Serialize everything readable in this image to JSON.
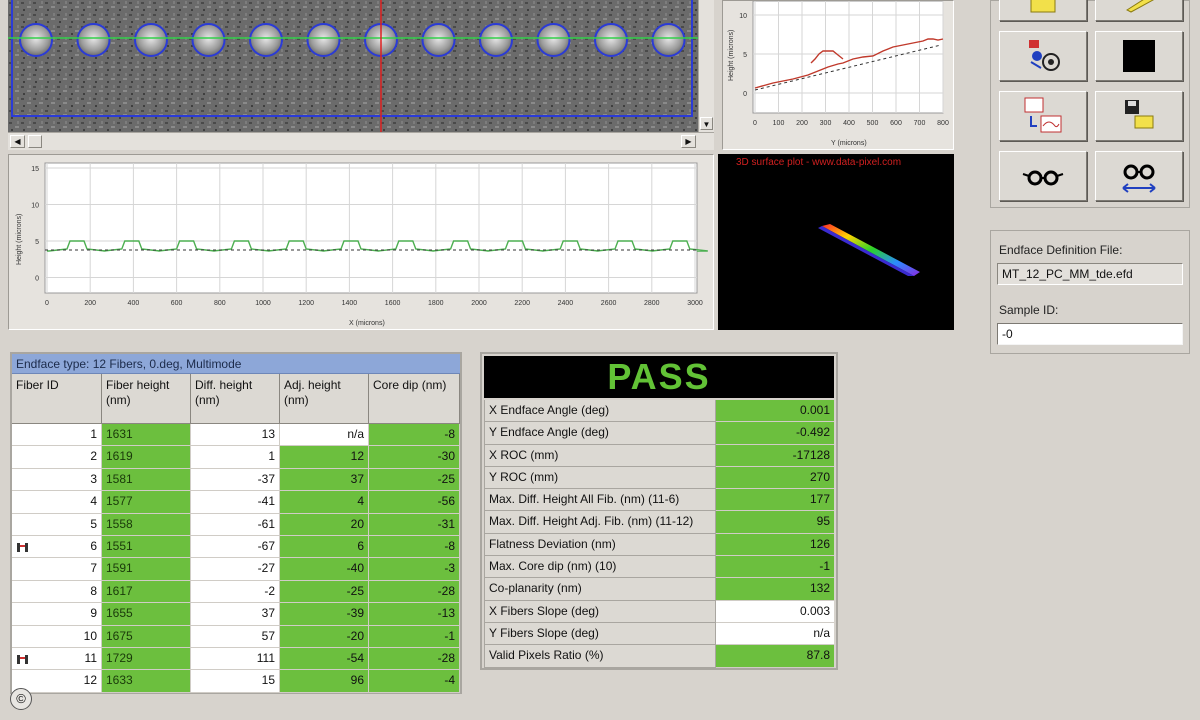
{
  "colors": {
    "pass_green": "#6cbf3e",
    "header_blue": "#8da7d8",
    "plot_green": "#4caf50",
    "plot_red": "#c0392b"
  },
  "y_profile_chart": {
    "ylabel": "Height (microns)",
    "xlabel": "Y (microns)",
    "y_ticks": [
      "10",
      "5",
      "0"
    ],
    "x_ticks": [
      "0",
      "100",
      "200",
      "300",
      "400",
      "500",
      "600",
      "700",
      "800"
    ]
  },
  "x_profile_chart": {
    "ylabel": "Height (microns)",
    "xlabel": "X (microns)",
    "y_ticks": [
      "15",
      "10",
      "5",
      "0"
    ],
    "x_ticks": [
      "0",
      "200",
      "400",
      "600",
      "800",
      "1000",
      "1200",
      "1400",
      "1600",
      "1800",
      "2000",
      "2200",
      "2400",
      "2600",
      "2800",
      "3000"
    ]
  },
  "surface_plot": {
    "title": "3D surface plot - www.data-pixel.com"
  },
  "tools": [
    "folder-icon",
    "pencil-icon",
    "measure-settings-icon",
    "black-square-icon",
    "compare-plot-icon",
    "save-open-icon",
    "glasses-icon",
    "glasses-compare-icon"
  ],
  "info": {
    "def_label": "Endface Definition File:",
    "def_value": "MT_12_PC_MM_tde.efd",
    "sample_label": "Sample ID:",
    "sample_value": "-0"
  },
  "fiber_table": {
    "title": "Endface type: 12 Fibers, 0.deg, Multimode",
    "columns": [
      "Fiber ID",
      "Fiber height (nm)",
      "Diff. height (nm)",
      "Adj. height (nm)",
      "Core dip (nm)"
    ],
    "rows": [
      {
        "id": "1",
        "height": "1631",
        "diff": "13",
        "adj": "n/a",
        "dip": "-8"
      },
      {
        "id": "2",
        "height": "1619",
        "diff": "1",
        "adj": "12",
        "dip": "-30"
      },
      {
        "id": "3",
        "height": "1581",
        "diff": "-37",
        "adj": "37",
        "dip": "-25"
      },
      {
        "id": "4",
        "height": "1577",
        "diff": "-41",
        "adj": "4",
        "dip": "-56"
      },
      {
        "id": "5",
        "height": "1558",
        "diff": "-61",
        "adj": "20",
        "dip": "-31"
      },
      {
        "id": "6",
        "height": "1551",
        "diff": "-67",
        "adj": "6",
        "dip": "-8"
      },
      {
        "id": "7",
        "height": "1591",
        "diff": "-27",
        "adj": "-40",
        "dip": "-3"
      },
      {
        "id": "8",
        "height": "1617",
        "diff": "-2",
        "adj": "-25",
        "dip": "-28"
      },
      {
        "id": "9",
        "height": "1655",
        "diff": "37",
        "adj": "-39",
        "dip": "-13"
      },
      {
        "id": "10",
        "height": "1675",
        "diff": "57",
        "adj": "-20",
        "dip": "-1"
      },
      {
        "id": "11",
        "height": "1729",
        "diff": "111",
        "adj": "-54",
        "dip": "-28"
      },
      {
        "id": "12",
        "height": "1633",
        "diff": "15",
        "adj": "96",
        "dip": "-4"
      }
    ]
  },
  "results": {
    "status": "PASS",
    "rows": [
      {
        "label": "X Endface Angle (deg)",
        "value": "0.001",
        "pass": true
      },
      {
        "label": "Y Endface Angle (deg)",
        "value": "-0.492",
        "pass": true
      },
      {
        "label": "X ROC (mm)",
        "value": "-17128",
        "pass": true
      },
      {
        "label": "Y ROC (mm)",
        "value": "270",
        "pass": true
      },
      {
        "label": "Max. Diff. Height All Fib. (nm) (11-6)",
        "value": "177",
        "pass": true
      },
      {
        "label": "Max. Diff. Height Adj. Fib. (nm) (11-12)",
        "value": "95",
        "pass": true
      },
      {
        "label": "Flatness Deviation (nm)",
        "value": "126",
        "pass": true
      },
      {
        "label": "Max. Core dip (nm) (10)",
        "value": "-1",
        "pass": true
      },
      {
        "label": "Co-planarity (nm)",
        "value": "132",
        "pass": true
      },
      {
        "label": "X Fibers Slope (deg)",
        "value": "0.003",
        "pass": false
      },
      {
        "label": "Y Fibers Slope (deg)",
        "value": "n/a",
        "pass": false
      },
      {
        "label": "Valid Pixels Ratio (%)",
        "value": "87.8",
        "pass": true
      }
    ]
  },
  "copyright_symbol": "©"
}
